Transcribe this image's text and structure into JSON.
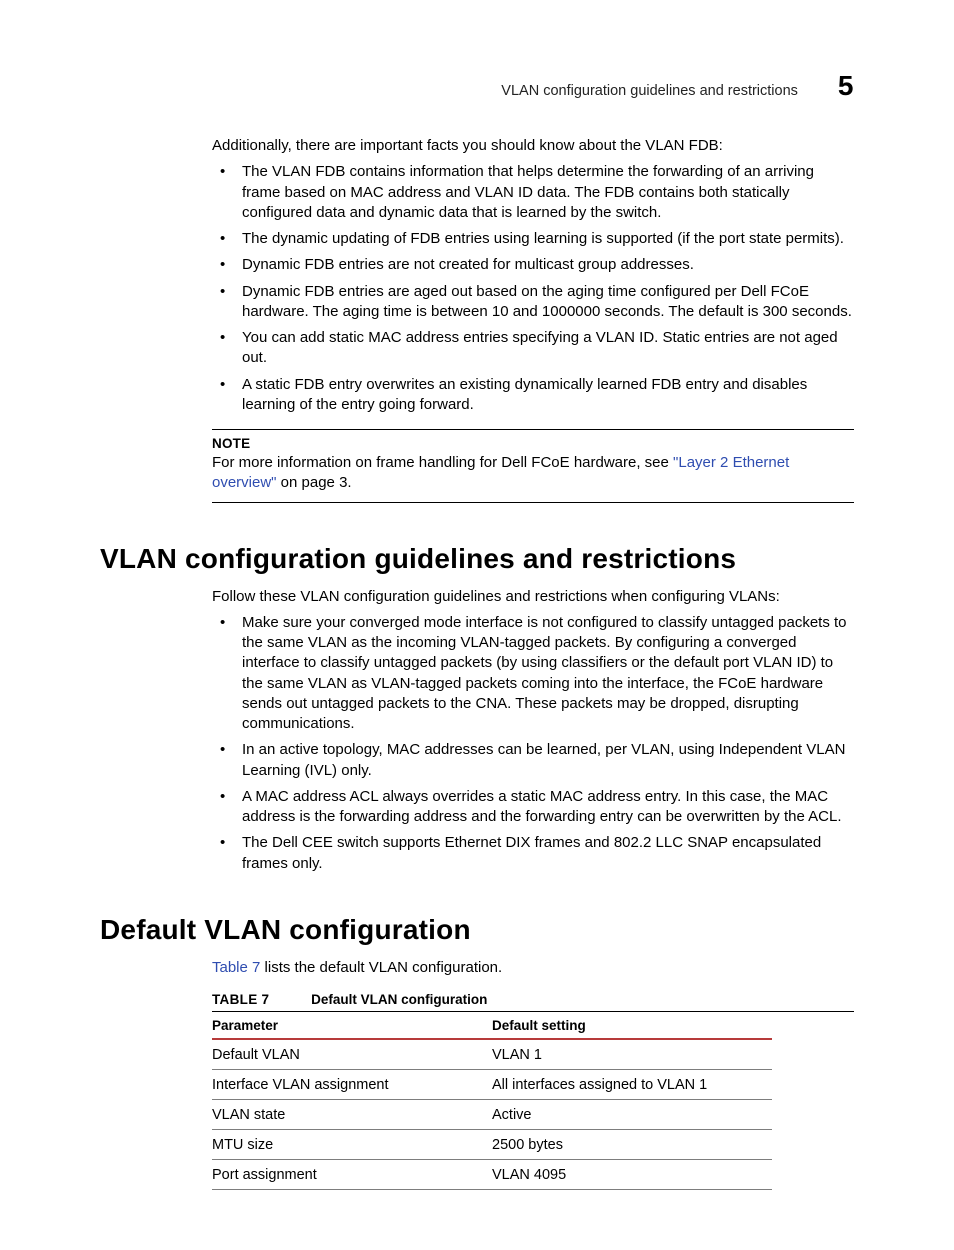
{
  "running_head": {
    "text": "VLAN configuration guidelines and restrictions",
    "chapter_number": "5"
  },
  "intro_paragraph": "Additionally, there are important facts you should know about the VLAN FDB:",
  "fdb_bullets": [
    "The VLAN FDB contains information that helps determine the forwarding of an arriving frame based on MAC address and VLAN ID data. The FDB contains both statically configured data and dynamic data that is learned by the switch.",
    "The dynamic updating of FDB entries using learning is supported (if the port state permits).",
    "Dynamic FDB entries are not created for multicast group addresses.",
    "Dynamic FDB entries are aged out based on the aging time configured per Dell FCoE hardware. The aging time is between 10 and 1000000 seconds. The default is 300 seconds.",
    "You can add static MAC address entries specifying a VLAN ID. Static entries are not aged out.",
    "A static FDB entry overwrites an existing dynamically learned FDB entry and disables learning of the entry going forward."
  ],
  "note": {
    "label": "NOTE",
    "text_before": "For more information on frame handling for Dell FCoE hardware, see ",
    "link_text": "\"Layer 2 Ethernet overview\"",
    "text_after": " on page 3."
  },
  "section1": {
    "heading": "VLAN configuration guidelines and restrictions",
    "intro": "Follow these VLAN configuration guidelines and restrictions when configuring VLANs:",
    "bullets": [
      "Make sure your converged mode interface is not configured to classify untagged packets to the same VLAN as the incoming VLAN-tagged packets.  By configuring  a converged interface to classify untagged packets (by using classifiers or the default port VLAN ID) to the same VLAN as VLAN-tagged packets coming into the interface, the FCoE hardware sends out untagged packets to the CNA. These packets may be  dropped, disrupting communications.",
      "In an active topology, MAC addresses can be learned, per VLAN, using Independent VLAN Learning (IVL) only.",
      "A MAC address ACL always overrides a static MAC address entry. In this case, the MAC address is the forwarding address and the forwarding entry can be overwritten by the ACL.",
      "The Dell CEE switch supports Ethernet DIX frames and 802.2 LLC SNAP encapsulated frames only."
    ]
  },
  "section2": {
    "heading": "Default VLAN configuration",
    "intro_before": "",
    "intro_link": "Table 7",
    "intro_after": " lists the default VLAN configuration.",
    "table": {
      "caption_label": "TABLE 7",
      "caption_title": "Default VLAN configuration",
      "headers": [
        "Parameter",
        "Default setting"
      ],
      "rows": [
        [
          "Default VLAN",
          "VLAN 1"
        ],
        [
          "Interface VLAN assignment",
          "All interfaces assigned to VLAN 1"
        ],
        [
          "VLAN state",
          "Active"
        ],
        [
          "MTU size",
          "2500 bytes"
        ],
        [
          "Port assignment",
          "VLAN 4095"
        ]
      ]
    }
  }
}
